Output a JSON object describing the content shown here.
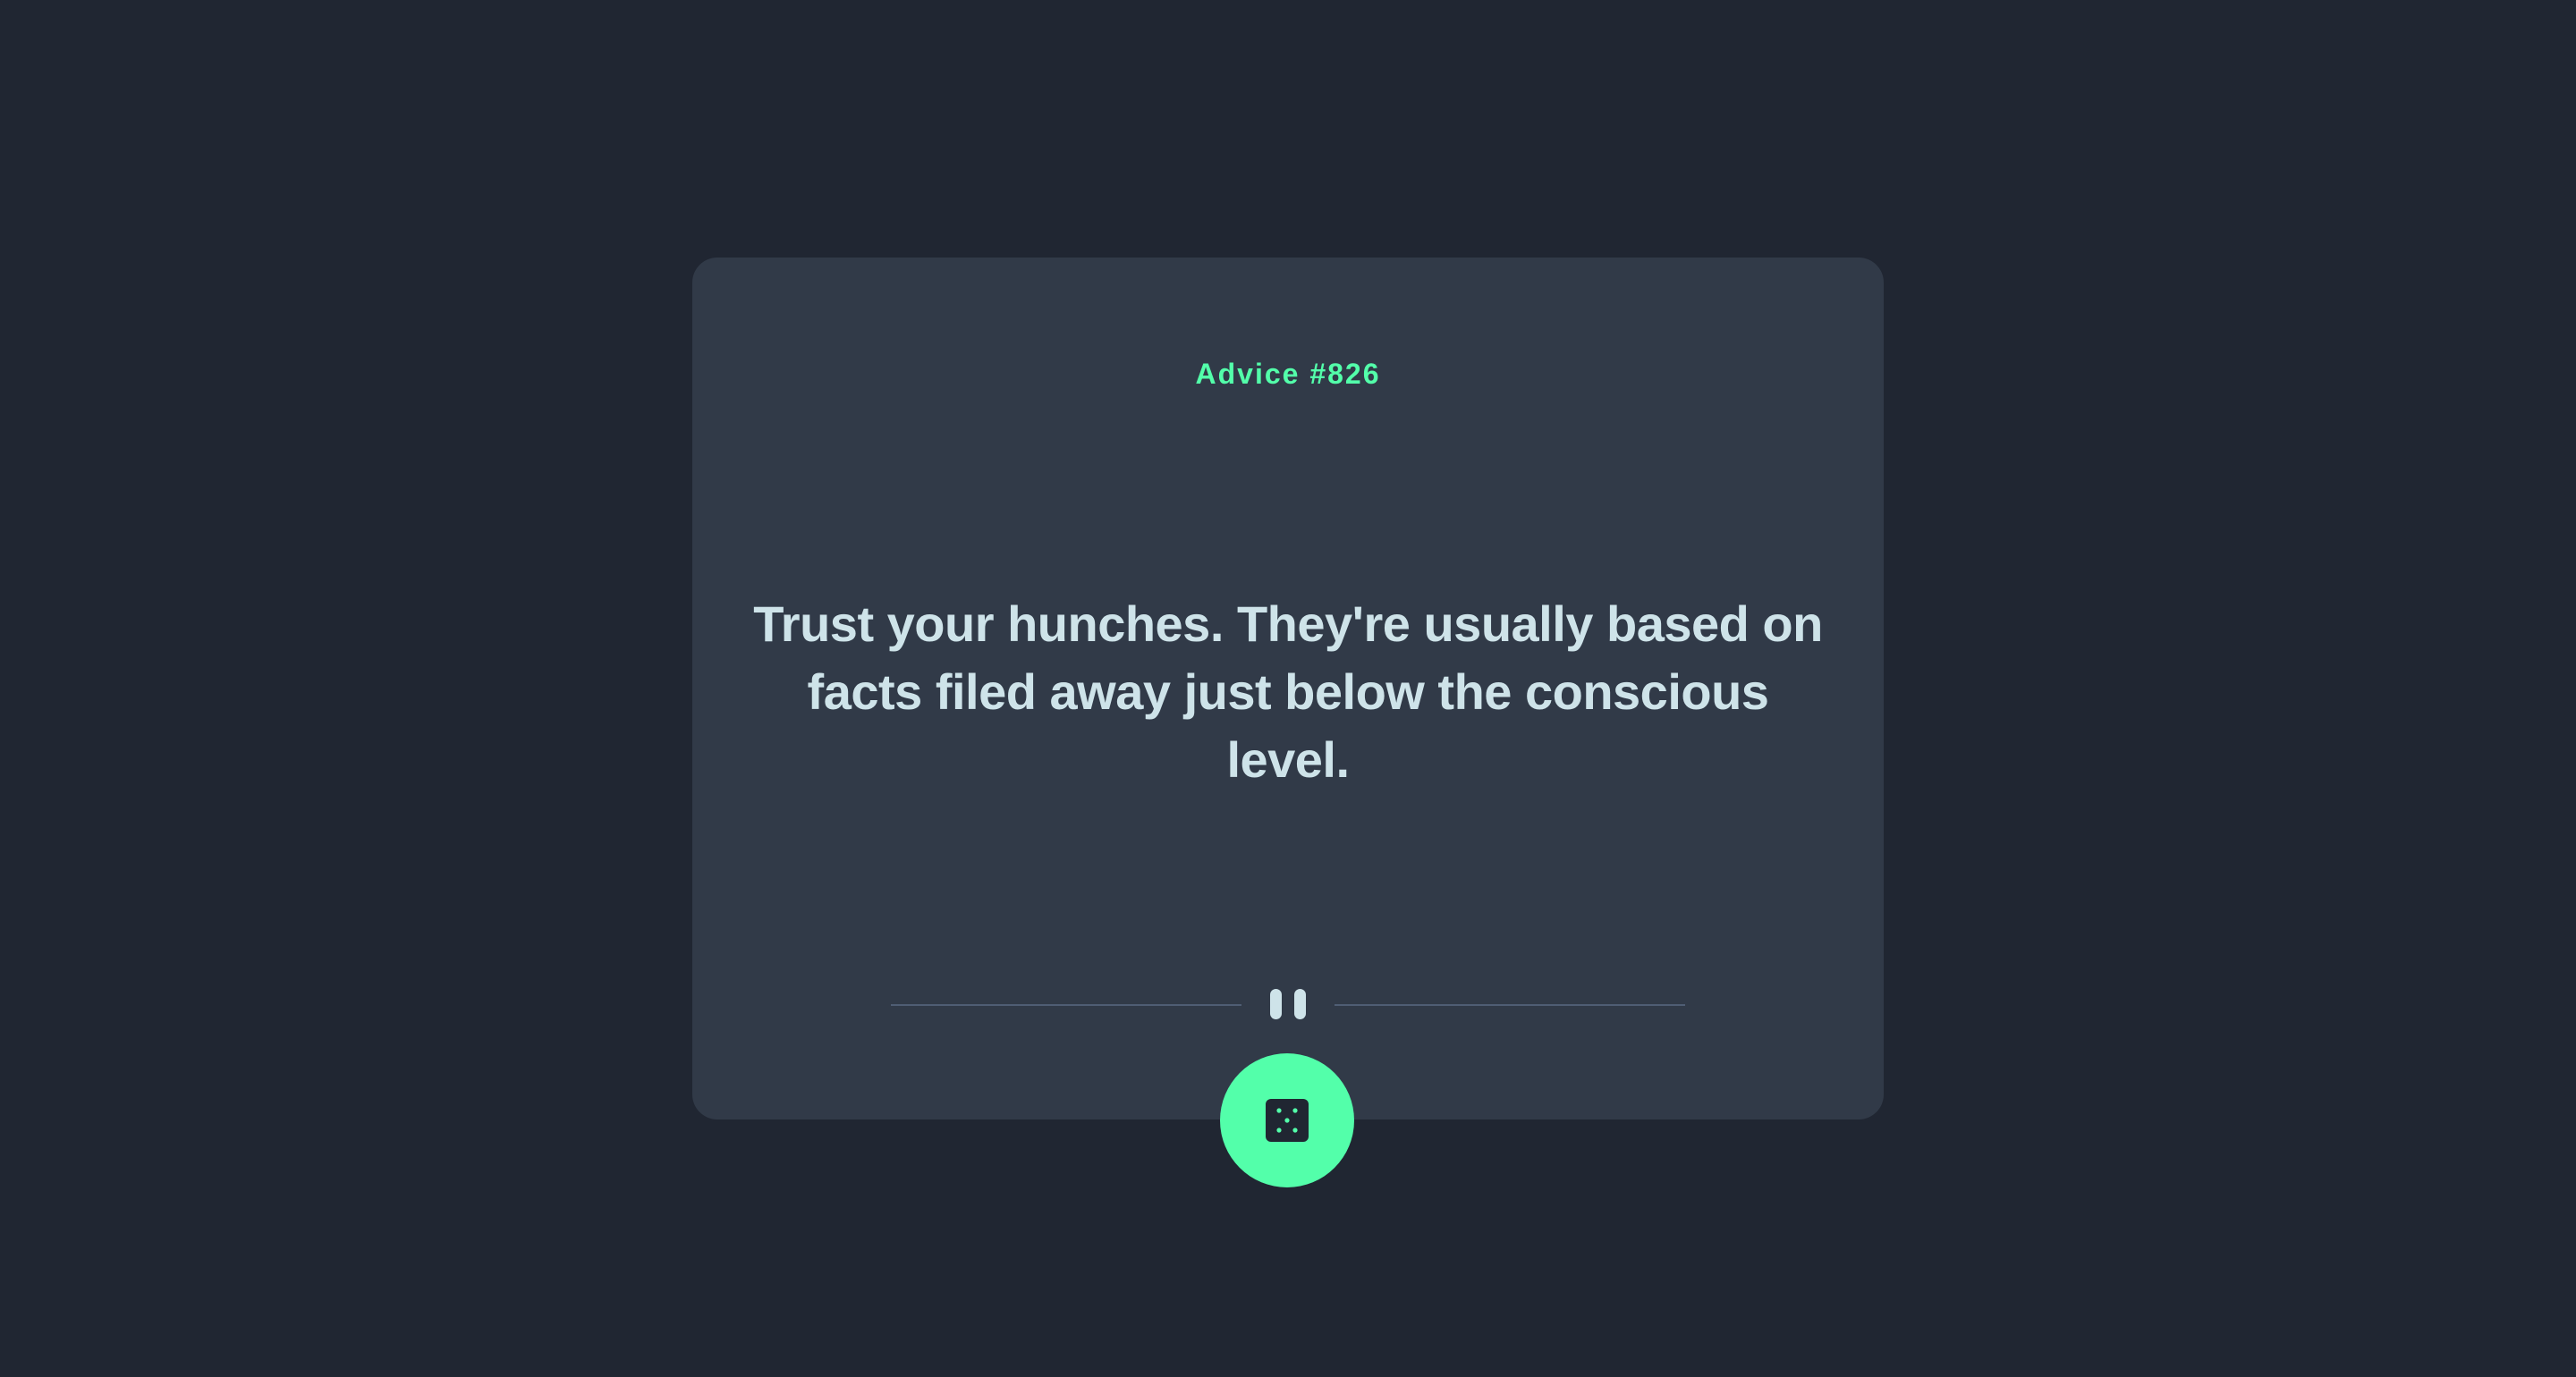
{
  "advice": {
    "label": "Advice #826",
    "text": "Trust your hunches. They're usually based on facts filed away just below the conscious level."
  },
  "icons": {
    "divider": "pause-icon",
    "button": "dice-icon"
  },
  "colors": {
    "background": "#202632",
    "card": "#313a48",
    "accent": "#53ffaa",
    "text": "#cee3e9",
    "divider": "#4f5d74"
  }
}
